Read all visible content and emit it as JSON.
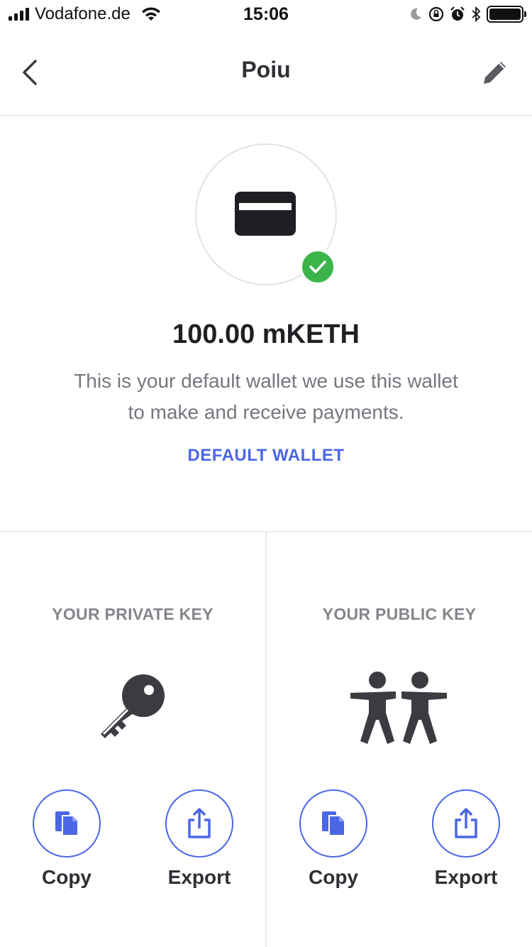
{
  "status_bar": {
    "carrier": "Vodafone.de",
    "time": "15:06"
  },
  "nav": {
    "title": "Poiu",
    "back_icon": "chevron-left-icon",
    "edit_icon": "pencil-icon"
  },
  "wallet": {
    "balance": "100.00 mKETH",
    "description": "This is your default wallet we use this wallet to make and receive payments.",
    "default_link": "DEFAULT WALLET",
    "icon": "credit-card-icon",
    "badge_icon": "checkmark-icon"
  },
  "private_key": {
    "title": "YOUR PRIVATE KEY",
    "icon": "key-icon",
    "copy_label": "Copy",
    "export_label": "Export"
  },
  "public_key": {
    "title": "YOUR PUBLIC KEY",
    "icon": "people-icon",
    "copy_label": "Copy",
    "export_label": "Export"
  },
  "colors": {
    "accent": "#4b66e6",
    "success": "#3bb54a",
    "text_primary": "#1f2024",
    "text_secondary": "#75777e"
  }
}
